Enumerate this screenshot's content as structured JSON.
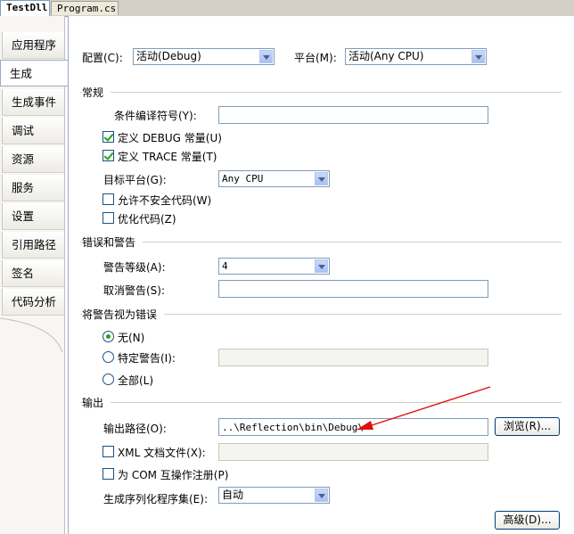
{
  "doc_tabs": [
    "TestDll",
    "Program.cs"
  ],
  "side_tabs": [
    "应用程序",
    "生成",
    "生成事件",
    "调试",
    "资源",
    "服务",
    "设置",
    "引用路径",
    "签名",
    "代码分析"
  ],
  "top": {
    "config_label": "配置(C):",
    "config_value": "活动(Debug)",
    "platform_label": "平台(M):",
    "platform_value": "活动(Any CPU)"
  },
  "general": {
    "title": "常规",
    "symbols_label": "条件编译符号(Y):",
    "symbols_value": "",
    "debug_const": "定义 DEBUG 常量(U)",
    "trace_const": "定义 TRACE 常量(T)",
    "target_label": "目标平台(G):",
    "target_value": "Any CPU",
    "unsafe": "允许不安全代码(W)",
    "optimize": "优化代码(Z)"
  },
  "errors": {
    "title": "错误和警告",
    "level_label": "警告等级(A):",
    "level_value": "4",
    "suppress_label": "取消警告(S):",
    "suppress_value": ""
  },
  "treat": {
    "title": "将警告视为错误",
    "none": "无(N)",
    "specific": "特定警告(I):",
    "all": "全部(L)"
  },
  "output": {
    "title": "输出",
    "path_label": "输出路径(O):",
    "path_value": "..\\Reflection\\bin\\Debug\\",
    "browse": "浏览(R)...",
    "xml_doc": "XML 文档文件(X):",
    "com": "为 COM 互操作注册(P)",
    "serial_label": "生成序列化程序集(E):",
    "serial_value": "自动",
    "advanced": "高级(D)..."
  },
  "colors": {
    "annotation_arrow": "#e01010",
    "check_green": "#21a121"
  }
}
